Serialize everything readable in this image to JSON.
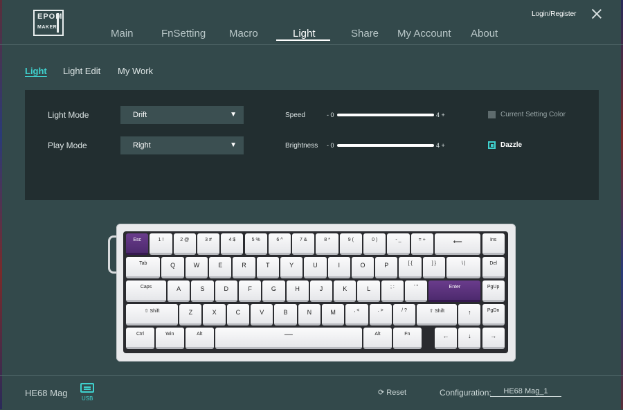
{
  "brand": {
    "line1": "EPOM",
    "line2": "MAKER"
  },
  "header": {
    "login": "Login/Register"
  },
  "nav": [
    {
      "label": "Main"
    },
    {
      "label": "FnSetting"
    },
    {
      "label": "Macro"
    },
    {
      "label": "Light",
      "active": true
    },
    {
      "label": "Share"
    },
    {
      "label": "My Account"
    },
    {
      "label": "About"
    }
  ],
  "subtabs": [
    {
      "label": "Light",
      "active": true
    },
    {
      "label": "Light Edit"
    },
    {
      "label": "My Work"
    }
  ],
  "settings": {
    "light_mode_label": "Light Mode",
    "light_mode_value": "Drift",
    "play_mode_label": "Play Mode",
    "play_mode_value": "Right",
    "speed_label": "Speed",
    "speed_min": "- 0",
    "speed_max": "4 +",
    "brightness_label": "Brightness",
    "brightness_min": "- 0",
    "brightness_max": "4 +",
    "current_setting_color": "Current Setting Color",
    "dazzle": "Dazzle"
  },
  "keyboard": {
    "rows": [
      [
        "Esc",
        "1 !",
        "2 @",
        "3 #",
        "4 $",
        "5 %",
        "6 ^",
        "7 &",
        "8 *",
        "9 (",
        "0 )",
        "- _",
        "= +",
        "⟵",
        "Ins"
      ],
      [
        "Tab",
        "Q",
        "W",
        "E",
        "R",
        "T",
        "Y",
        "U",
        "I",
        "O",
        "P",
        "[ {",
        "] }",
        "\\ |",
        "Del"
      ],
      [
        "Caps",
        "A",
        "S",
        "D",
        "F",
        "G",
        "H",
        "J",
        "K",
        "L",
        "; :",
        "' \"",
        "Enter",
        "PgUp"
      ],
      [
        "⇧ Shift",
        "Z",
        "X",
        "C",
        "V",
        "B",
        "N",
        "M",
        ", <",
        ". >",
        "/ ?",
        "⇧ Shift",
        "↑",
        "PgDn"
      ],
      [
        "Ctrl",
        "Win",
        "Alt",
        "—",
        "Alt",
        "Fn",
        "←",
        "↓",
        "→"
      ]
    ],
    "highlighted": [
      "Esc",
      "Enter"
    ]
  },
  "status": {
    "device": "HE68 Mag",
    "connection": "USB",
    "reset": "Reset",
    "config_label": "Configuration:",
    "config_value": "HE68 Mag_1"
  },
  "colors": {
    "accent": "#3fd1ce",
    "highlight_key": "#5a3480",
    "background": "#33494b",
    "panel": "#222e30"
  }
}
